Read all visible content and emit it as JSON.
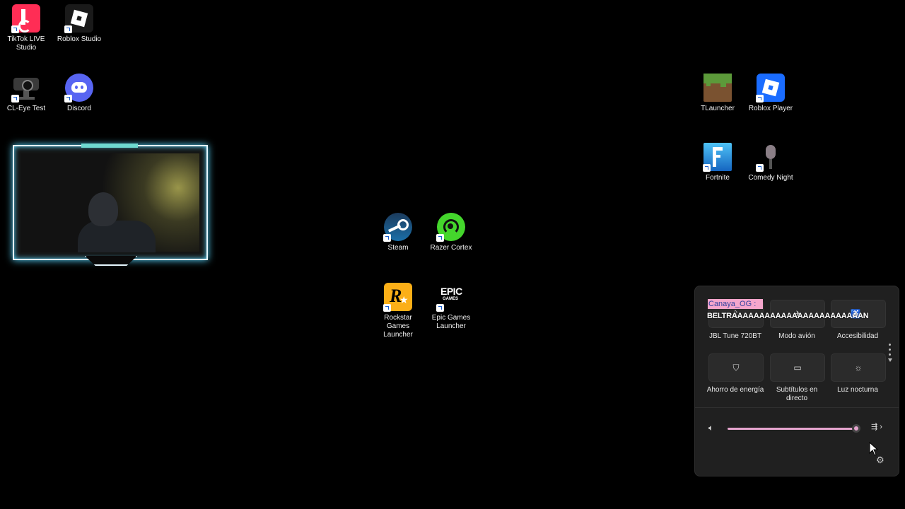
{
  "desktop_icons": [
    {
      "label": "TikTok LIVE Studio",
      "icon": "tiktok-icon",
      "color": "#ff2d55"
    },
    {
      "label": "Roblox Studio",
      "icon": "roblox-studio-icon",
      "color": "#1a1a1a"
    },
    {
      "label": "CL-Eye Test",
      "icon": "camera-icon",
      "color": "#2a2a2a"
    },
    {
      "label": "Discord",
      "icon": "discord-icon",
      "color": "#5865f2"
    },
    {
      "label": "TLauncher",
      "icon": "grass-block-icon",
      "color": "#5c8a3a"
    },
    {
      "label": "Roblox Player",
      "icon": "roblox-icon",
      "color": "#1a6cff"
    },
    {
      "label": "Fortnite",
      "icon": "fortnite-icon",
      "color": "#1e88e5"
    },
    {
      "label": "Comedy Night",
      "icon": "microphone-icon",
      "color": "#444444"
    },
    {
      "label": "Steam",
      "icon": "steam-icon",
      "color": "#1b2838"
    },
    {
      "label": "Razer Cortex",
      "icon": "razer-icon",
      "color": "#44d62c"
    },
    {
      "label": "Rockstar Games Launcher",
      "icon": "rockstar-icon",
      "color": "#fcaf17"
    },
    {
      "label": "Epic Games Launcher",
      "icon": "epic-games-icon",
      "color": "#111111"
    }
  ],
  "quick_settings": {
    "tiles": [
      {
        "label": "JBL Tune 720BT",
        "icon": "bluetooth-icon"
      },
      {
        "label": "Modo avión",
        "icon": "airplane-icon"
      },
      {
        "label": "Accesibilidad",
        "icon": "accessibility-icon"
      },
      {
        "label": "Ahorro de energía",
        "icon": "battery-saver-icon"
      },
      {
        "label": "Subtítulos en directo",
        "icon": "captions-icon"
      },
      {
        "label": "Luz nocturna",
        "icon": "night-light-icon"
      }
    ],
    "volume_level": 0.97,
    "accent_color": "#e6a5cf"
  },
  "chat_overlay": {
    "username": "Canaya_OG :",
    "message": "BELTRAAAAAAAAAAAAAAAAAAAAAAAAN"
  },
  "webcam_overlay": {
    "glow_color": "#58d7ff"
  }
}
